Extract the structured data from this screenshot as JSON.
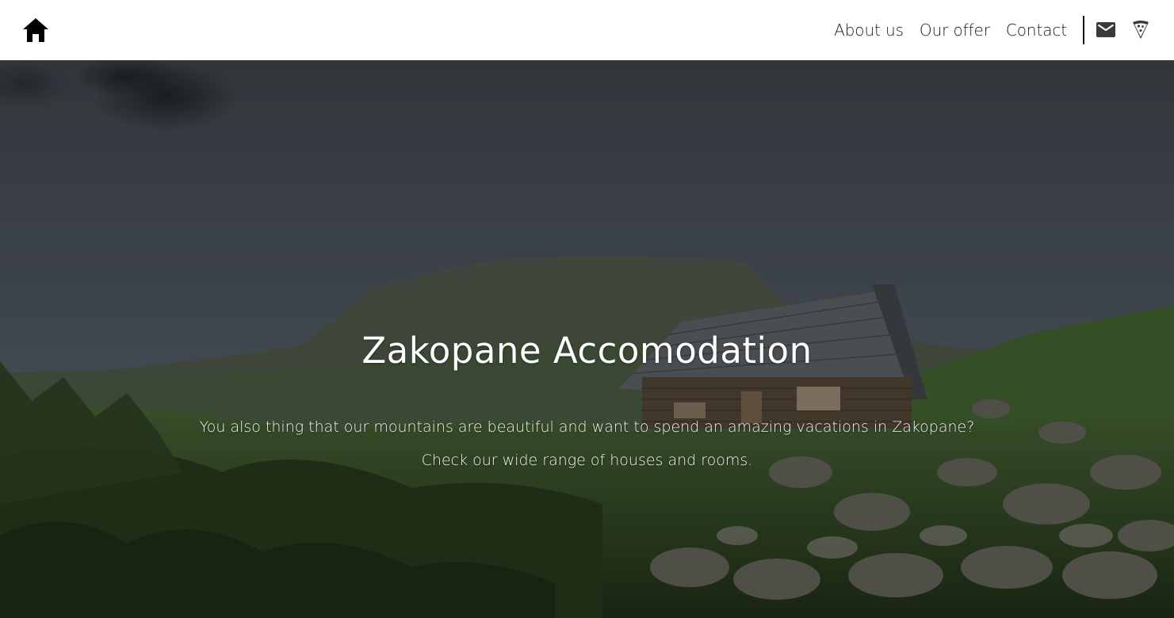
{
  "navbar": {
    "home_icon": "home-icon",
    "links": [
      {
        "label": "About us"
      },
      {
        "label": "Our offer"
      },
      {
        "label": "Contact"
      }
    ],
    "mail_icon": "envelope-icon",
    "pizza_icon": "pizza-slice-icon"
  },
  "hero": {
    "title": "Zakopane Accomodation",
    "line1": "You also thing that our mountains are beautiful and want to spend an amazing vacations in Zakopane?",
    "line2": "Check our wide range of houses and rooms."
  },
  "colors": {
    "navbar_bg": "#ffffff",
    "nav_text": "#1a1a1a",
    "hero_text": "#ffffff"
  }
}
